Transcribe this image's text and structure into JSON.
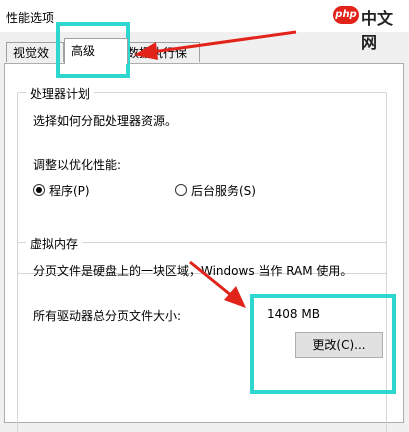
{
  "window": {
    "title": "性能选项"
  },
  "watermark": {
    "mark": "php",
    "text": "中文网"
  },
  "tabs": [
    {
      "label": "视觉效果"
    },
    {
      "label": "高级"
    },
    {
      "label": "数据执行保护"
    }
  ],
  "processor": {
    "legend": "处理器计划",
    "description": "选择如何分配处理器资源。",
    "optimize_label": "调整以优化性能:",
    "options": [
      {
        "label": "程序(P)",
        "checked": true
      },
      {
        "label": "后台服务(S)",
        "checked": false
      }
    ]
  },
  "virtual_memory": {
    "legend": "虚拟内存",
    "description": "分页文件是硬盘上的一块区域，Windows 当作 RAM 使用。",
    "total_label": "所有驱动器总分页文件大小:",
    "total_value": "1408 MB",
    "change_button": "更改(C)..."
  },
  "colors": {
    "highlight": "#2ed6d0",
    "arrow": "#e2231a"
  }
}
